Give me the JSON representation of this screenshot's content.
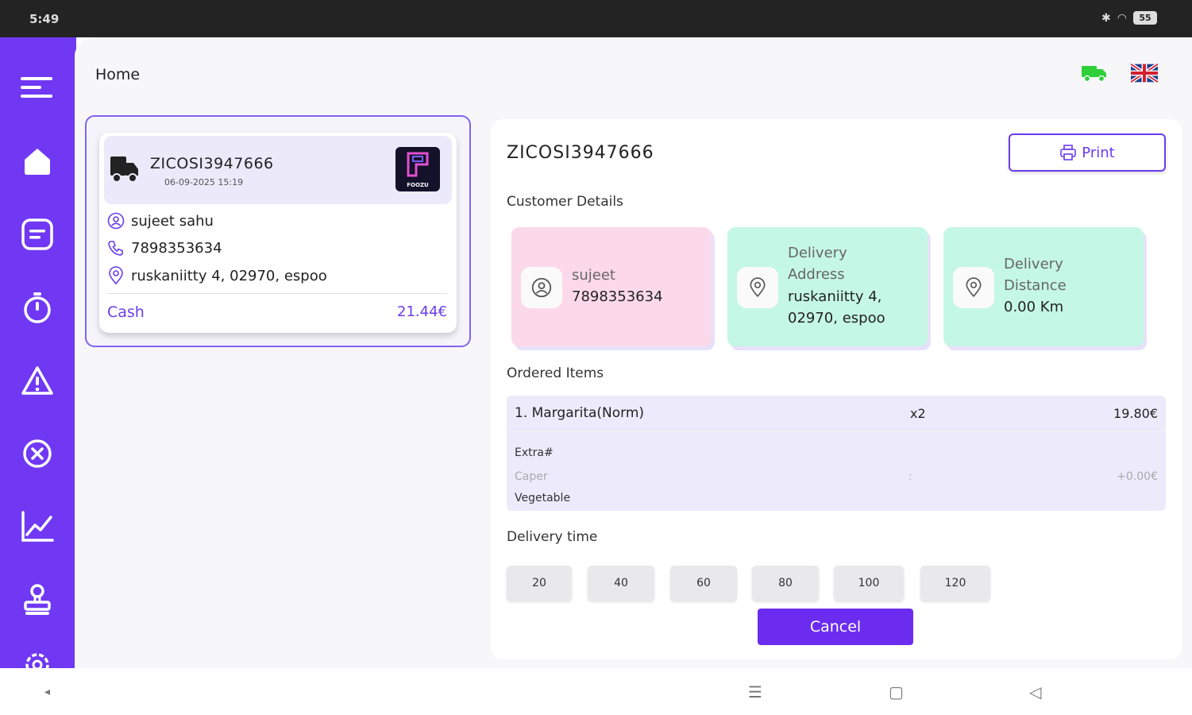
{
  "status_bar": {
    "time": "5:49",
    "bluetooth_icon": "bluetooth-icon",
    "wifi_icon": "wifi-icon",
    "battery": "55"
  },
  "sidebar": {
    "items": [
      {
        "icon": "menu-icon"
      },
      {
        "icon": "home-icon"
      },
      {
        "icon": "orders-icon"
      },
      {
        "icon": "timer-icon"
      },
      {
        "icon": "warning-icon"
      },
      {
        "icon": "cancel-circle-icon"
      },
      {
        "icon": "chart-icon"
      },
      {
        "icon": "stamp-icon"
      },
      {
        "icon": "settings-icon"
      }
    ],
    "color": "#7038f3"
  },
  "header": {
    "title": "Home",
    "delivery_status_icon": "truck-icon",
    "language_icon": "uk-flag-icon"
  },
  "order_card": {
    "id": "ZICOSI3947666",
    "datetime": "06-09-2025 15:19",
    "logo_text": "FOOZU",
    "customer_name": "sujeet sahu",
    "phone": "7898353634",
    "address": "ruskaniitty 4, 02970, espoo",
    "payment": "Cash",
    "total": "21.44€"
  },
  "detail": {
    "order_id": "ZICOSI3947666",
    "print_label": "Print",
    "customer_section": "Customer Details",
    "customer_card": {
      "line1": "sujeet",
      "line2": "7898353634"
    },
    "address_card": {
      "label1": "Delivery",
      "label2": "Address",
      "value1": "ruskaniitty 4,",
      "value2": "02970, espoo"
    },
    "distance_card": {
      "label1": "Delivery",
      "label2": "Distance",
      "value": "0.00 Km"
    },
    "items_section": "Ordered Items",
    "items": [
      {
        "name": "1. Margarita(Norm)",
        "qty": "x2",
        "price": "19.80€"
      }
    ],
    "extras_label": "Extra#",
    "extra": {
      "name": "Caper",
      "separator": ":",
      "price": "+0.00€"
    },
    "extra_category": "Vegetable",
    "delivery_section": "Delivery time",
    "delivery_times": [
      "20",
      "40",
      "60",
      "80",
      "100",
      "120"
    ],
    "cancel_label": "Cancel"
  },
  "colors": {
    "accent": "#6b2cf0",
    "pink_card": "#fcd9ea",
    "mint_card": "#c5f7e6"
  }
}
